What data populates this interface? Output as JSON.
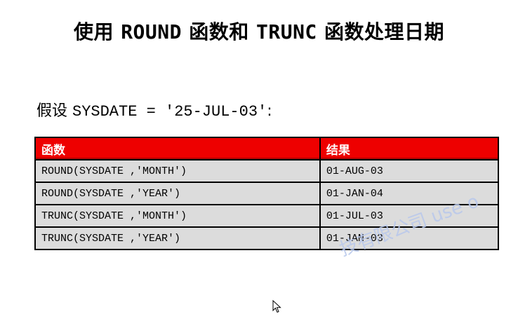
{
  "title": {
    "prefix": "使用 ",
    "round": "ROUND",
    "middle": " 函数和 ",
    "trunc": "TRUNC",
    "suffix": " 函数处理日期"
  },
  "assumption": {
    "label": "假设 ",
    "expression": "SYSDATE = '25-JUL-03'",
    "colon": ":"
  },
  "table": {
    "headers": [
      "函数",
      "结果"
    ],
    "rows": [
      [
        "ROUND(SYSDATE ,'MONTH')",
        "01-AUG-03"
      ],
      [
        "ROUND(SYSDATE ,'YEAR')",
        "01-JAN-04"
      ],
      [
        "TRUNC(SYSDATE ,'MONTH')",
        "01-JUL-03"
      ],
      [
        "TRUNC(SYSDATE ,'YEAR')",
        "01-JAN-03"
      ]
    ]
  },
  "watermark": "技有限公司 use o",
  "colors": {
    "header_bg": "#ee0000",
    "row_bg": "#dcdcdc"
  }
}
